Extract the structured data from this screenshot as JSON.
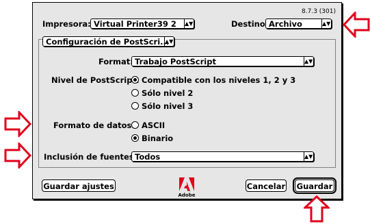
{
  "version": "8.7.3 (301)",
  "printer": {
    "label": "Impresora:",
    "value": "Virtual Printer39 2"
  },
  "destination": {
    "label": "Destino:",
    "value": "Archivo"
  },
  "panel": {
    "value": "Configuración de PostScri..."
  },
  "format": {
    "label": "Format:",
    "value": "Trabajo PostScript"
  },
  "ps_level": {
    "label": "Nivel de PostScript:",
    "options": [
      {
        "label": "Compatible con los niveles 1, 2 y 3",
        "selected": true
      },
      {
        "label": "Sólo nivel 2",
        "selected": false
      },
      {
        "label": "Sólo nivel 3",
        "selected": false
      }
    ]
  },
  "data_format": {
    "label": "Formato de datos:",
    "options": [
      {
        "label": "ASCII",
        "selected": false
      },
      {
        "label": "Binario",
        "selected": true
      }
    ]
  },
  "font_inclusion": {
    "label": "Inclusión de fuentes:",
    "value": "Todos"
  },
  "buttons": {
    "save_settings": "Guardar ajustes",
    "cancel": "Cancelar",
    "save": "Guardar"
  },
  "logo_text": "Adobe",
  "colors": {
    "arrow": "#e0001b",
    "dialog_bg": "#e6e6e6"
  }
}
